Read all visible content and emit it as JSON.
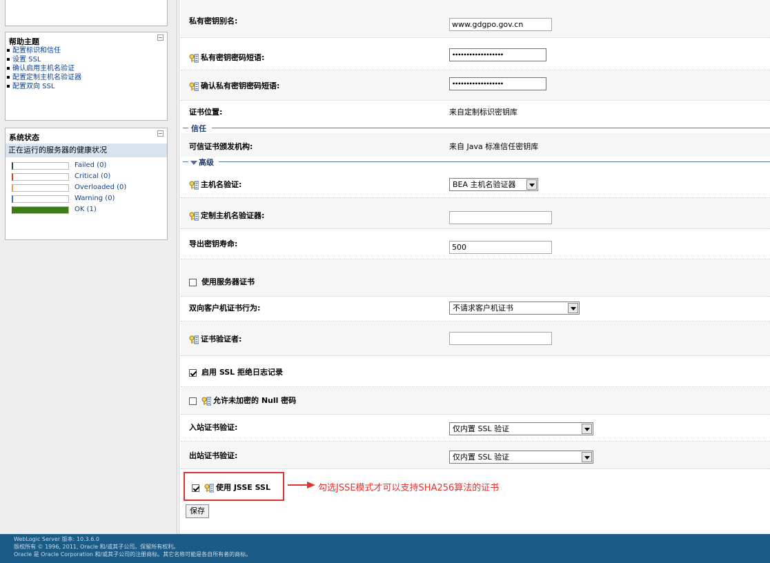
{
  "sidebar": {
    "help": {
      "title": "帮助主题",
      "items": [
        {
          "label": "配置标识和信任"
        },
        {
          "label": "设置 SSL"
        },
        {
          "label": "确认启用主机名验证"
        },
        {
          "label": "配置定制主机名验证器"
        },
        {
          "label": "配置双向 SSL"
        }
      ]
    },
    "status": {
      "title": "系统状态",
      "subtitle": "正在运行的服务器的健康状况",
      "items": [
        {
          "label": "Failed (0)",
          "color": "#3a3a3a",
          "fraction": 0
        },
        {
          "label": "Critical (0)",
          "color": "#d93a26",
          "fraction": 0
        },
        {
          "label": "Overloaded (0)",
          "color": "#e3a23a",
          "fraction": 0
        },
        {
          "label": "Warning (0)",
          "color": "#3f6fa8",
          "fraction": 0
        },
        {
          "label": "OK (1)",
          "color": "#3e7a16",
          "fraction": 1
        }
      ]
    }
  },
  "form": {
    "private_key_alias": {
      "label": "私有密钥别名:",
      "value": "www.gdgpo.gov.cn"
    },
    "private_key_passphrase": {
      "label": "私有密钥密码短语:",
      "value": "••••••••••••••••••"
    },
    "confirm_passphrase": {
      "label": "确认私有密钥密码短语:",
      "value": "••••••••••••••••••"
    },
    "cert_location": {
      "label": "证书位置:",
      "value": "来自定制标识密钥库"
    },
    "trust_section": {
      "title": "信任"
    },
    "trusted_ca": {
      "label": "可信证书颁发机构:",
      "value": "来自 Java 标准信任密钥库"
    },
    "advanced_section": {
      "title": "高级"
    },
    "hostname_verification": {
      "label": "主机名验证:",
      "value": "BEA 主机名验证器"
    },
    "custom_hostname_verifier": {
      "label": "定制主机名验证器:",
      "value": ""
    },
    "export_key_lifespan": {
      "label": "导出密钥寿命:",
      "value": "500"
    },
    "use_server_certs": {
      "label": "使用服务器证书"
    },
    "two_way_client_cert": {
      "label": "双向客户机证书行为:",
      "value": "不请求客户机证书"
    },
    "cert_authenticator": {
      "label": "证书验证者:",
      "value": ""
    },
    "ssl_rejection_logging": {
      "label": "启用 SSL 拒绝日志记录"
    },
    "allow_null_cipher": {
      "label": "允许未加密的 Null 密码"
    },
    "inbound_cert_validation": {
      "label": "入站证书验证:",
      "value": "仅内置 SSL 验证"
    },
    "outbound_cert_validation": {
      "label": "出站证书验证:",
      "value": "仅内置 SSL 验证"
    },
    "use_jsse": {
      "label": "使用 JSSE SSL"
    },
    "save_label": "保存"
  },
  "annotation": {
    "text": "勾选JSSE模式才可以支持SHA256算法的证书",
    "color": "#e53030"
  },
  "footer": {
    "line1": "WebLogic Server 版本: 10.3.6.0",
    "line2": "版权所有 © 1996, 2011, Oracle 和/或其子公司。保留所有权利。",
    "line3": "Oracle 是 Oracle Corporation 和/或其子公司的注册商标。其它名称可能是各自所有者的商标。"
  }
}
